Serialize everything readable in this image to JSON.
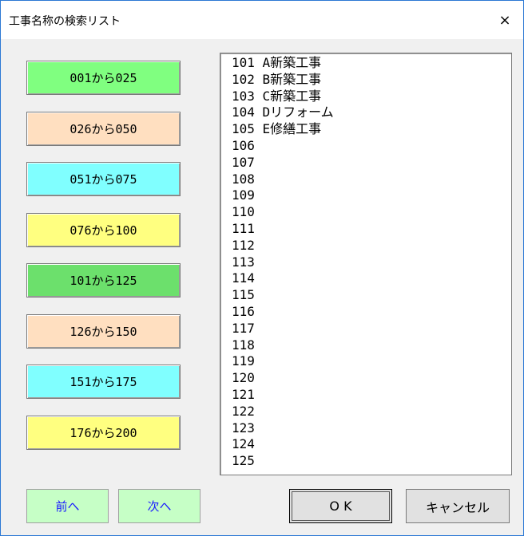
{
  "window": {
    "title": "工事名称の検索リスト",
    "close_icon": "×"
  },
  "range_buttons": [
    {
      "label": "001から025",
      "color": "#80ff80"
    },
    {
      "label": "026から050",
      "color": "#ffdfc0"
    },
    {
      "label": "051から075",
      "color": "#80ffff"
    },
    {
      "label": "076から100",
      "color": "#ffff80"
    },
    {
      "label": "101から125",
      "color": "#6ce06c"
    },
    {
      "label": "126から150",
      "color": "#ffdfc0"
    },
    {
      "label": "151から175",
      "color": "#80ffff"
    },
    {
      "label": "176から200",
      "color": "#ffff80"
    }
  ],
  "list_items": [
    "101 A新築工事",
    "102 B新築工事",
    "103 C新築工事",
    "104 Dリフォーム",
    "105 E修繕工事",
    "106",
    "107",
    "108",
    "109",
    "110",
    "111",
    "112",
    "113",
    "114",
    "115",
    "116",
    "117",
    "118",
    "119",
    "120",
    "121",
    "122",
    "123",
    "124",
    "125"
  ],
  "nav": {
    "prev_label": "前へ",
    "next_label": "次へ"
  },
  "buttons": {
    "ok_label": "O K",
    "cancel_label": "キャンセル"
  }
}
